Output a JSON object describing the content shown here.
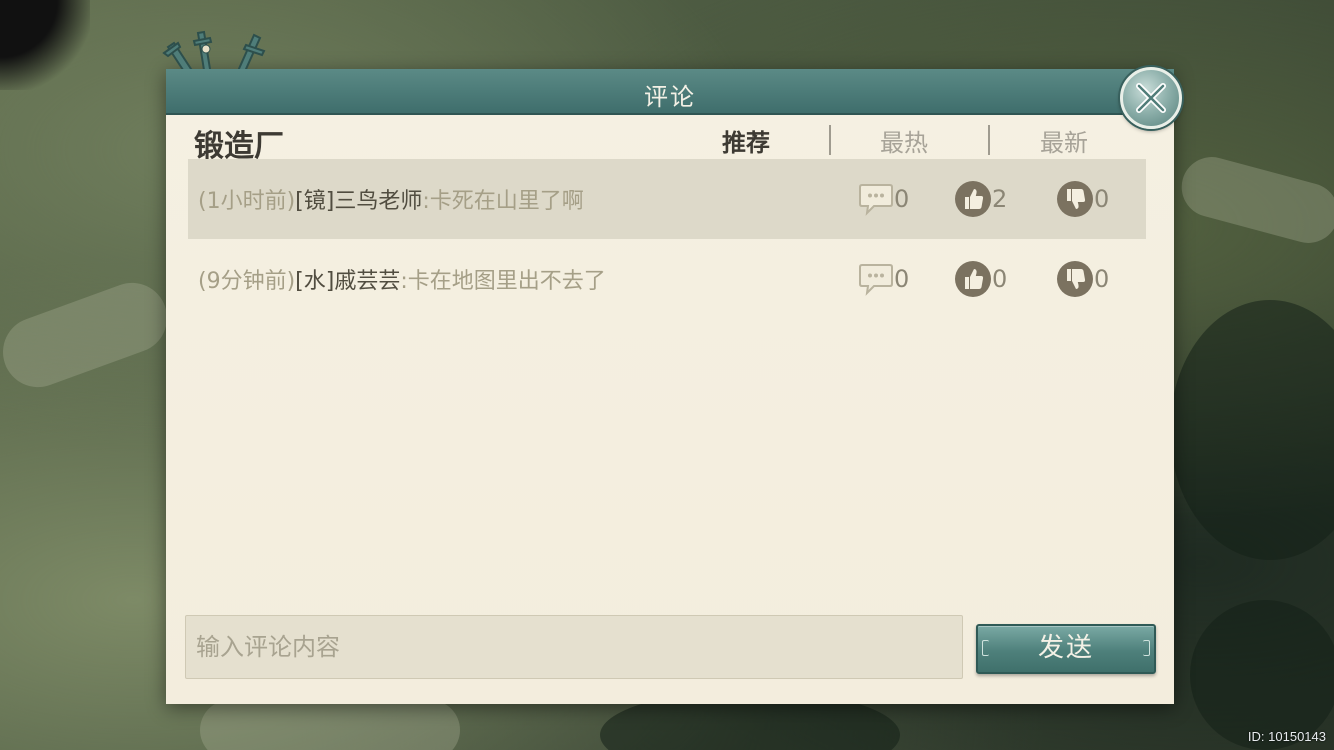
{
  "dialog": {
    "title": "评论",
    "location": "锻造厂"
  },
  "tabs": [
    {
      "label": "推荐",
      "active": true
    },
    {
      "label": "最热",
      "active": false
    },
    {
      "label": "最新",
      "active": false
    }
  ],
  "comments": [
    {
      "time": "(1小时前)",
      "tag": "[镜]",
      "author": "三鸟老师",
      "separator": ":",
      "content": "卡死在山里了啊",
      "replies": "0",
      "likes": "2",
      "dislikes": "0",
      "highlighted": true
    },
    {
      "time": "(9分钟前)",
      "tag": "[水]",
      "author": "戚芸芸",
      "separator": ":",
      "content": "卡在地图里出不去了",
      "replies": "0",
      "likes": "0",
      "dislikes": "0",
      "highlighted": false
    }
  ],
  "input": {
    "placeholder": "输入评论内容",
    "value": ""
  },
  "send_label": "发送",
  "footer_id": "ID: 10150143",
  "colors": {
    "header": "#4a7a77",
    "panel": "#f4efe0",
    "highlight_row": "#ddd9c9",
    "accent": "#4e807b"
  },
  "icons": {
    "close": "close-x-icon",
    "reply": "speech-bubble-icon",
    "like": "thumbs-up-icon",
    "dislike": "thumbs-down-icon"
  }
}
